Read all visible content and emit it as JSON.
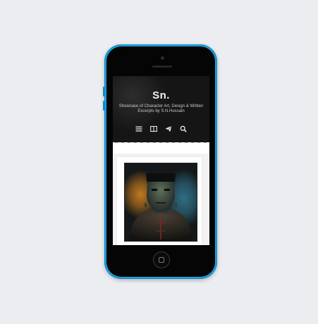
{
  "site": {
    "title": "Sn.",
    "tagline": "Showcase of Character Art, Design & Written Excerpts by S.N.Hussain"
  },
  "nav": [
    {
      "icon": "menu-icon"
    },
    {
      "icon": "book-icon"
    },
    {
      "icon": "send-icon"
    },
    {
      "icon": "search-icon"
    }
  ],
  "artwork": {
    "subject": "portrait-artwork"
  },
  "colors": {
    "phone_body": "#1a9fe0",
    "background": "#ebedf0",
    "header_bg": "#161616",
    "screen_bg": "#ffffff"
  }
}
